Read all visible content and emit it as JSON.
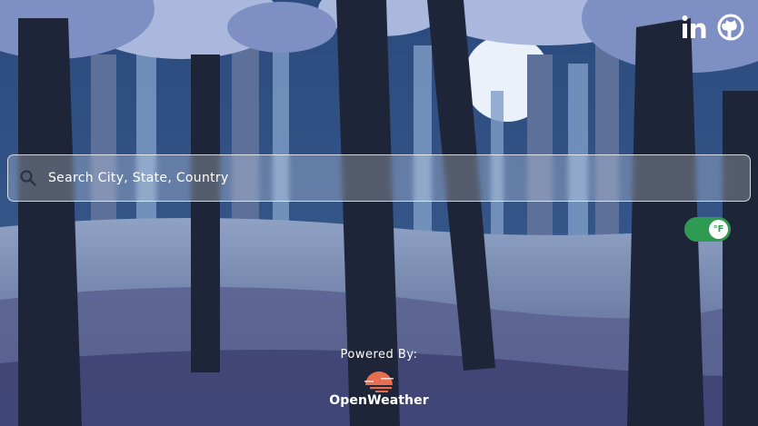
{
  "social": {
    "linkedin_icon": "linkedin-icon",
    "github_icon": "github-icon"
  },
  "search": {
    "placeholder": "Search City, State, Country",
    "value": ""
  },
  "unit_toggle": {
    "label": "°F",
    "state": "on",
    "color": "#2f9b52"
  },
  "footer": {
    "powered_by": "Powered By:",
    "provider": "OpenWeather",
    "logo_color": "#e96e50"
  },
  "colors": {
    "sky": "#2a3d6b",
    "moon": "#eaf1fb",
    "tree_dark": "#1e2538"
  }
}
